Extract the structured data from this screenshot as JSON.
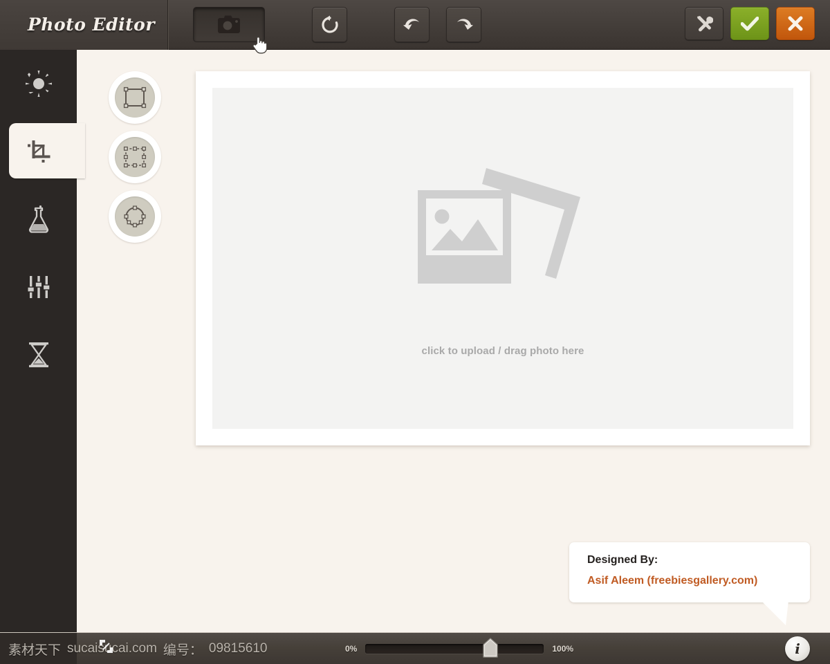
{
  "app": {
    "title": "Photo Editor",
    "background_color": "#f8f3ed",
    "sidebar_color": "#2b2725",
    "accent_green": "#7ba11e",
    "accent_orange": "#c1560c",
    "credit_link_color": "#c05b23"
  },
  "toolbar": {
    "buttons": [
      {
        "name": "camera-button",
        "icon": "camera-icon",
        "state": "active"
      },
      {
        "name": "reset-button",
        "icon": "rotate-ccw-icon",
        "state": "normal"
      },
      {
        "name": "undo-button",
        "icon": "undo-arrow-icon",
        "state": "normal"
      },
      {
        "name": "redo-button",
        "icon": "redo-arrow-icon",
        "state": "normal"
      }
    ],
    "actions": [
      {
        "name": "tools-button",
        "icon": "wrench-screwdriver-icon"
      },
      {
        "name": "apply-button",
        "icon": "check-icon"
      },
      {
        "name": "cancel-button",
        "icon": "close-x-icon"
      }
    ]
  },
  "sidebar": {
    "items": [
      {
        "name": "sidebar-item-brightness",
        "icon": "sun-icon",
        "active": false
      },
      {
        "name": "sidebar-item-crop",
        "icon": "crop-icon",
        "active": true
      },
      {
        "name": "sidebar-item-effects",
        "icon": "flask-icon",
        "active": false
      },
      {
        "name": "sidebar-item-adjust",
        "icon": "sliders-icon",
        "active": false
      },
      {
        "name": "sidebar-item-history",
        "icon": "hourglass-icon",
        "active": false
      }
    ]
  },
  "shape_tools": [
    {
      "name": "crop-shape-rectangle",
      "icon": "rectangle-handles-icon"
    },
    {
      "name": "crop-shape-freeform",
      "icon": "rectangle-eight-handles-icon"
    },
    {
      "name": "crop-shape-ellipse",
      "icon": "circle-handles-icon"
    }
  ],
  "canvas": {
    "placeholder_text": "click to upload / drag photo here",
    "placeholder_icon": "two-photos-icon"
  },
  "credit": {
    "label": "Designed By:",
    "author": "Asif Aleem (freebiesgallery.com)"
  },
  "statusbar": {
    "zoom_min_label": "0%",
    "zoom_max_label": "100%",
    "zoom_value_percent": 72,
    "info_glyph": "i",
    "fullscreen_icon": "expand-icon"
  },
  "watermark": {
    "site_cn": "素材天下",
    "site": "sucaisucai.com",
    "id_label": "编号：",
    "id_value": "09815610"
  }
}
